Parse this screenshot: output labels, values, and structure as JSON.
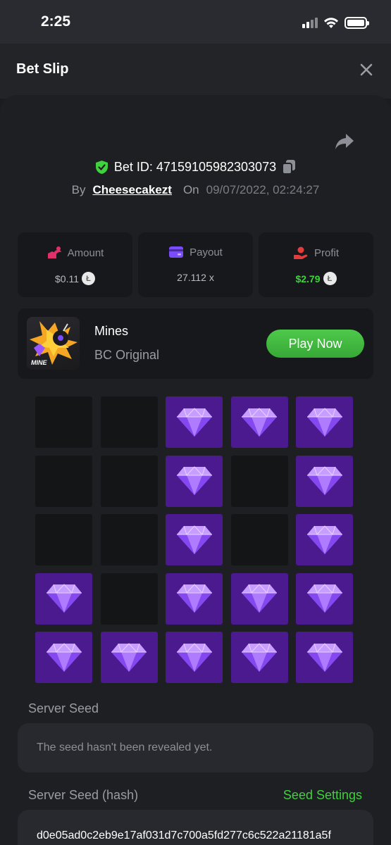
{
  "status_bar": {
    "time": "2:25"
  },
  "header": {
    "title": "Bet Slip"
  },
  "bet": {
    "id_label": "Bet ID: 47159105982303073",
    "by_label": "By",
    "user": "Cheesecakezt",
    "on_label": "On",
    "date": "09/07/2022, 02:24:27"
  },
  "stats": [
    {
      "label": "Amount",
      "value": "$0.11",
      "icon": "money-bag-icon",
      "coin": true,
      "color": "#e0306a"
    },
    {
      "label": "Payout",
      "value": "27.112 x",
      "icon": "card-icon",
      "coin": false,
      "color": "#7b4bff"
    },
    {
      "label": "Profit",
      "value": "$2.79",
      "icon": "hand-coin-icon",
      "coin": true,
      "color": "#e53b3b"
    }
  ],
  "game": {
    "name": "Mines",
    "subtitle": "BC Original",
    "thumb_label": "MINE",
    "play_label": "Play Now"
  },
  "grid": {
    "rows": 5,
    "cols": 5,
    "tiles": [
      0,
      0,
      1,
      1,
      1,
      0,
      0,
      1,
      0,
      1,
      0,
      0,
      1,
      0,
      1,
      1,
      0,
      1,
      1,
      1,
      1,
      1,
      1,
      1,
      1
    ]
  },
  "server_seed": {
    "label": "Server Seed",
    "value": "The seed hasn't been revealed yet."
  },
  "server_seed_hash": {
    "label": "Server Seed (hash)",
    "settings_label": "Seed Settings",
    "value": "d0e05ad0c2eb9e17af031d7c700a5fd277c6c522a21181a5f"
  },
  "colors": {
    "accent_green": "#3fd23d",
    "gem_tile": "#4a1a8e",
    "empty_tile": "#141517"
  }
}
